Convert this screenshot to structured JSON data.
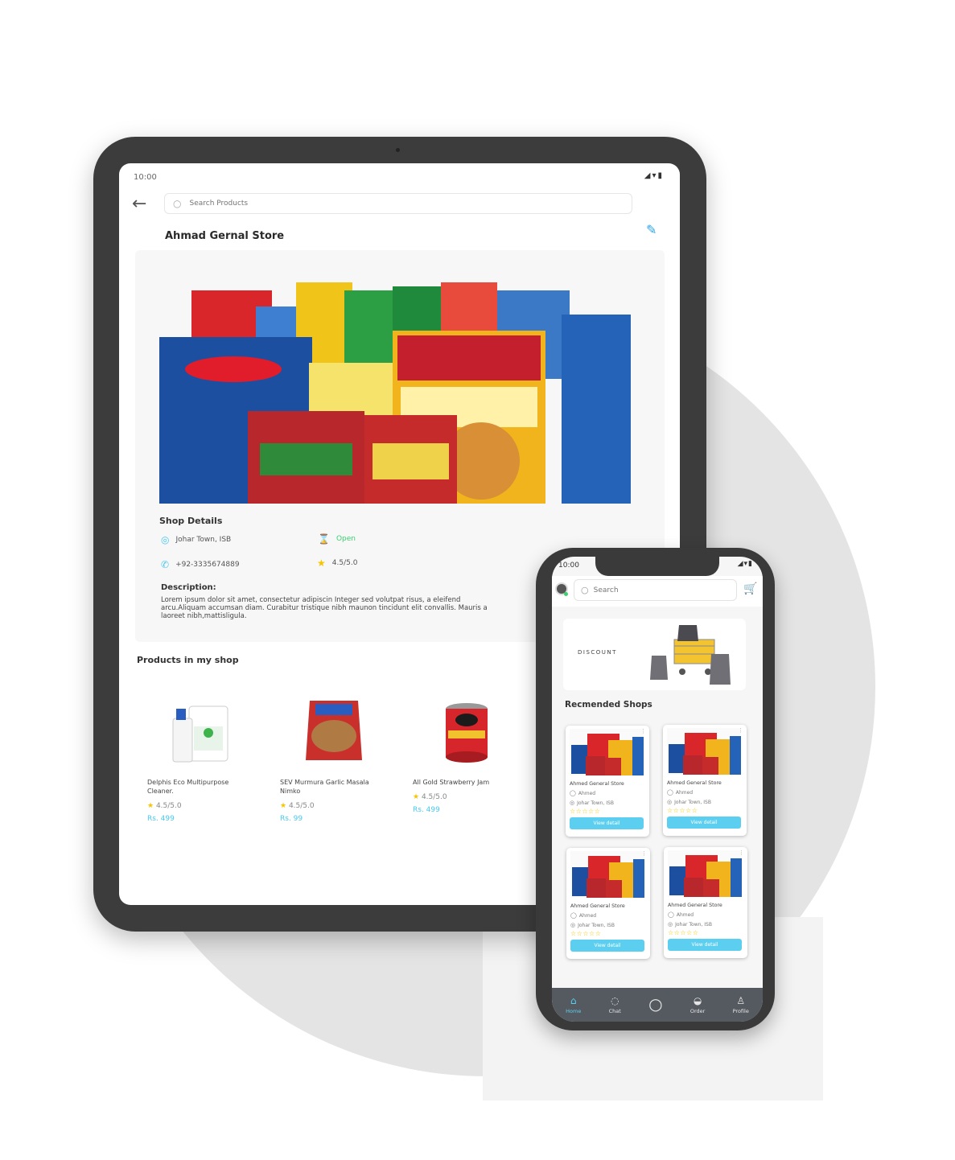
{
  "tablet": {
    "status_time": "10:00",
    "status_icons": "◢▾▮",
    "back_icon": "arrow-left-icon",
    "search_placeholder": "Search Products",
    "store_title": "Ahmad Gernal Store",
    "edit_icon": "pencil-icon",
    "shop_details_title": "Shop Details",
    "location": "Johar Town, ISB",
    "status": "Open",
    "phone": "+92-3335674889",
    "rating": "4.5/5.0",
    "description_title": "Description:",
    "description": "Lorem ipsum dolor sit amet, consectetur adipiscin Integer sed volutpat risus, a eleifend arcu.Aliquam accumsan diam. Curabitur tristique nibh maunon tincidunt elit convallis. Mauris a laoreet nibh,mattisligula.",
    "products_title": "Products in my shop",
    "products": [
      {
        "name": "Delphis Eco Multipurpose Cleaner.",
        "rating": "4.5/5.0",
        "price": "Rs. 499"
      },
      {
        "name": "SEV Murmura Garlic Masala Nimko",
        "rating": "4.5/5.0",
        "price": "Rs. 99"
      },
      {
        "name": "All Gold Strawberry Jam",
        "rating": "4.5/5.0",
        "price": "Rs. 499"
      }
    ],
    "colors": {
      "accent": "#4ac8ef",
      "open": "#3cd070",
      "star": "#f7c500"
    }
  },
  "phone": {
    "status_time": "10:00",
    "status_icons": "◢▾▮",
    "search_placeholder": "Search",
    "banner_label": "DISCOUNT",
    "recommended_title": "Recmended Shops",
    "shops": [
      {
        "name": "Ahmed General Store",
        "owner": "Ahmed",
        "location": "Johar Town, ISB",
        "stars": "☆☆☆☆☆",
        "button": "View detail"
      },
      {
        "name": "Ahmed General Store",
        "owner": "Ahmed",
        "location": "Johar Town, ISB",
        "stars": "☆☆☆☆☆",
        "button": "View detail"
      },
      {
        "name": "Ahmed General Store",
        "owner": "Ahmed",
        "location": "Johar Town, ISB",
        "stars": "☆☆☆☆☆",
        "button": "View detail"
      },
      {
        "name": "Ahmed General Store",
        "owner": "Ahmed",
        "location": "Johar Town, ISB",
        "stars": "☆☆☆☆☆",
        "button": "View detail"
      }
    ],
    "nav": [
      {
        "label": "Home",
        "icon": "home-icon"
      },
      {
        "label": "Chat",
        "icon": "chat-icon"
      },
      {
        "label": "",
        "icon": "search-icon"
      },
      {
        "label": "Order",
        "icon": "basket-icon"
      },
      {
        "label": "Profile",
        "icon": "user-icon"
      }
    ],
    "colors": {
      "button": "#5ccff0",
      "nav_bg": "#555a61"
    }
  }
}
